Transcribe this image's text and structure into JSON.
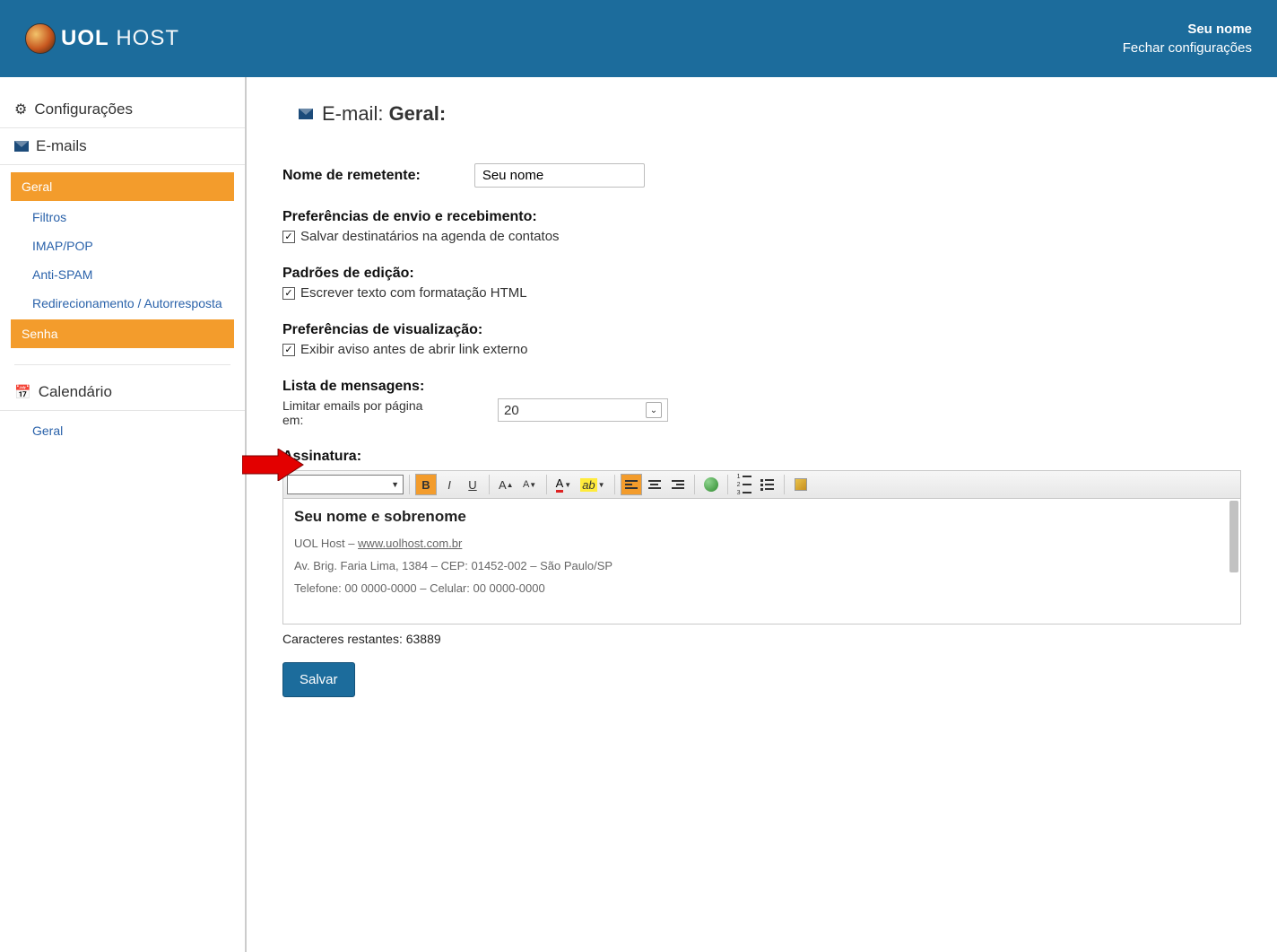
{
  "header": {
    "brand_bold": "UOL",
    "brand_light": " HOST",
    "user_label": "Seu nome",
    "close_label": "Fechar configurações"
  },
  "sidebar": {
    "config_heading": "Configurações",
    "emails_heading": "E-mails",
    "calendar_heading": "Calendário",
    "items": {
      "geral": "Geral",
      "filtros": "Filtros",
      "imap": "IMAP/POP",
      "antispam": "Anti-SPAM",
      "redir": "Redirecionamento / Autorresposta",
      "senha": "Senha",
      "cal_geral": "Geral"
    }
  },
  "main": {
    "title_prefix": "E-mail: ",
    "title_strong": "Geral:",
    "sender_label": "Nome de remetente:",
    "sender_value": "Seu nome",
    "prefs_send_heading": "Preferências de envio e recebimento:",
    "save_contacts_label": "Salvar destinatários na agenda de contatos",
    "edit_heading": "Padrões de edição:",
    "html_format_label": "Escrever texto com formatação HTML",
    "view_heading": "Preferências de visualização:",
    "warn_link_label": "Exibir aviso antes de abrir link externo",
    "list_heading": "Lista de mensagens:",
    "limit_label": "Limitar emails por página em:",
    "limit_value": "20",
    "signature_heading": "Assinatura:",
    "signature": {
      "name": "Seu nome e sobrenome",
      "host_prefix": "UOL Host – ",
      "host_link": "www.uolhost.com.br",
      "address": "Av. Brig. Faria Lima, 1384 – CEP: 01452-002 – São Paulo/SP",
      "phones": "Telefone: 00 0000-0000 – Celular: 00 0000-0000"
    },
    "chars_label": "Caracteres restantes: ",
    "chars_value": "63889",
    "save_btn": "Salvar"
  },
  "toolbar": {
    "bold": "B",
    "italic": "I",
    "underline": "U",
    "inc_font": "A",
    "dec_font": "A",
    "color": "A",
    "highlight": "ab"
  }
}
